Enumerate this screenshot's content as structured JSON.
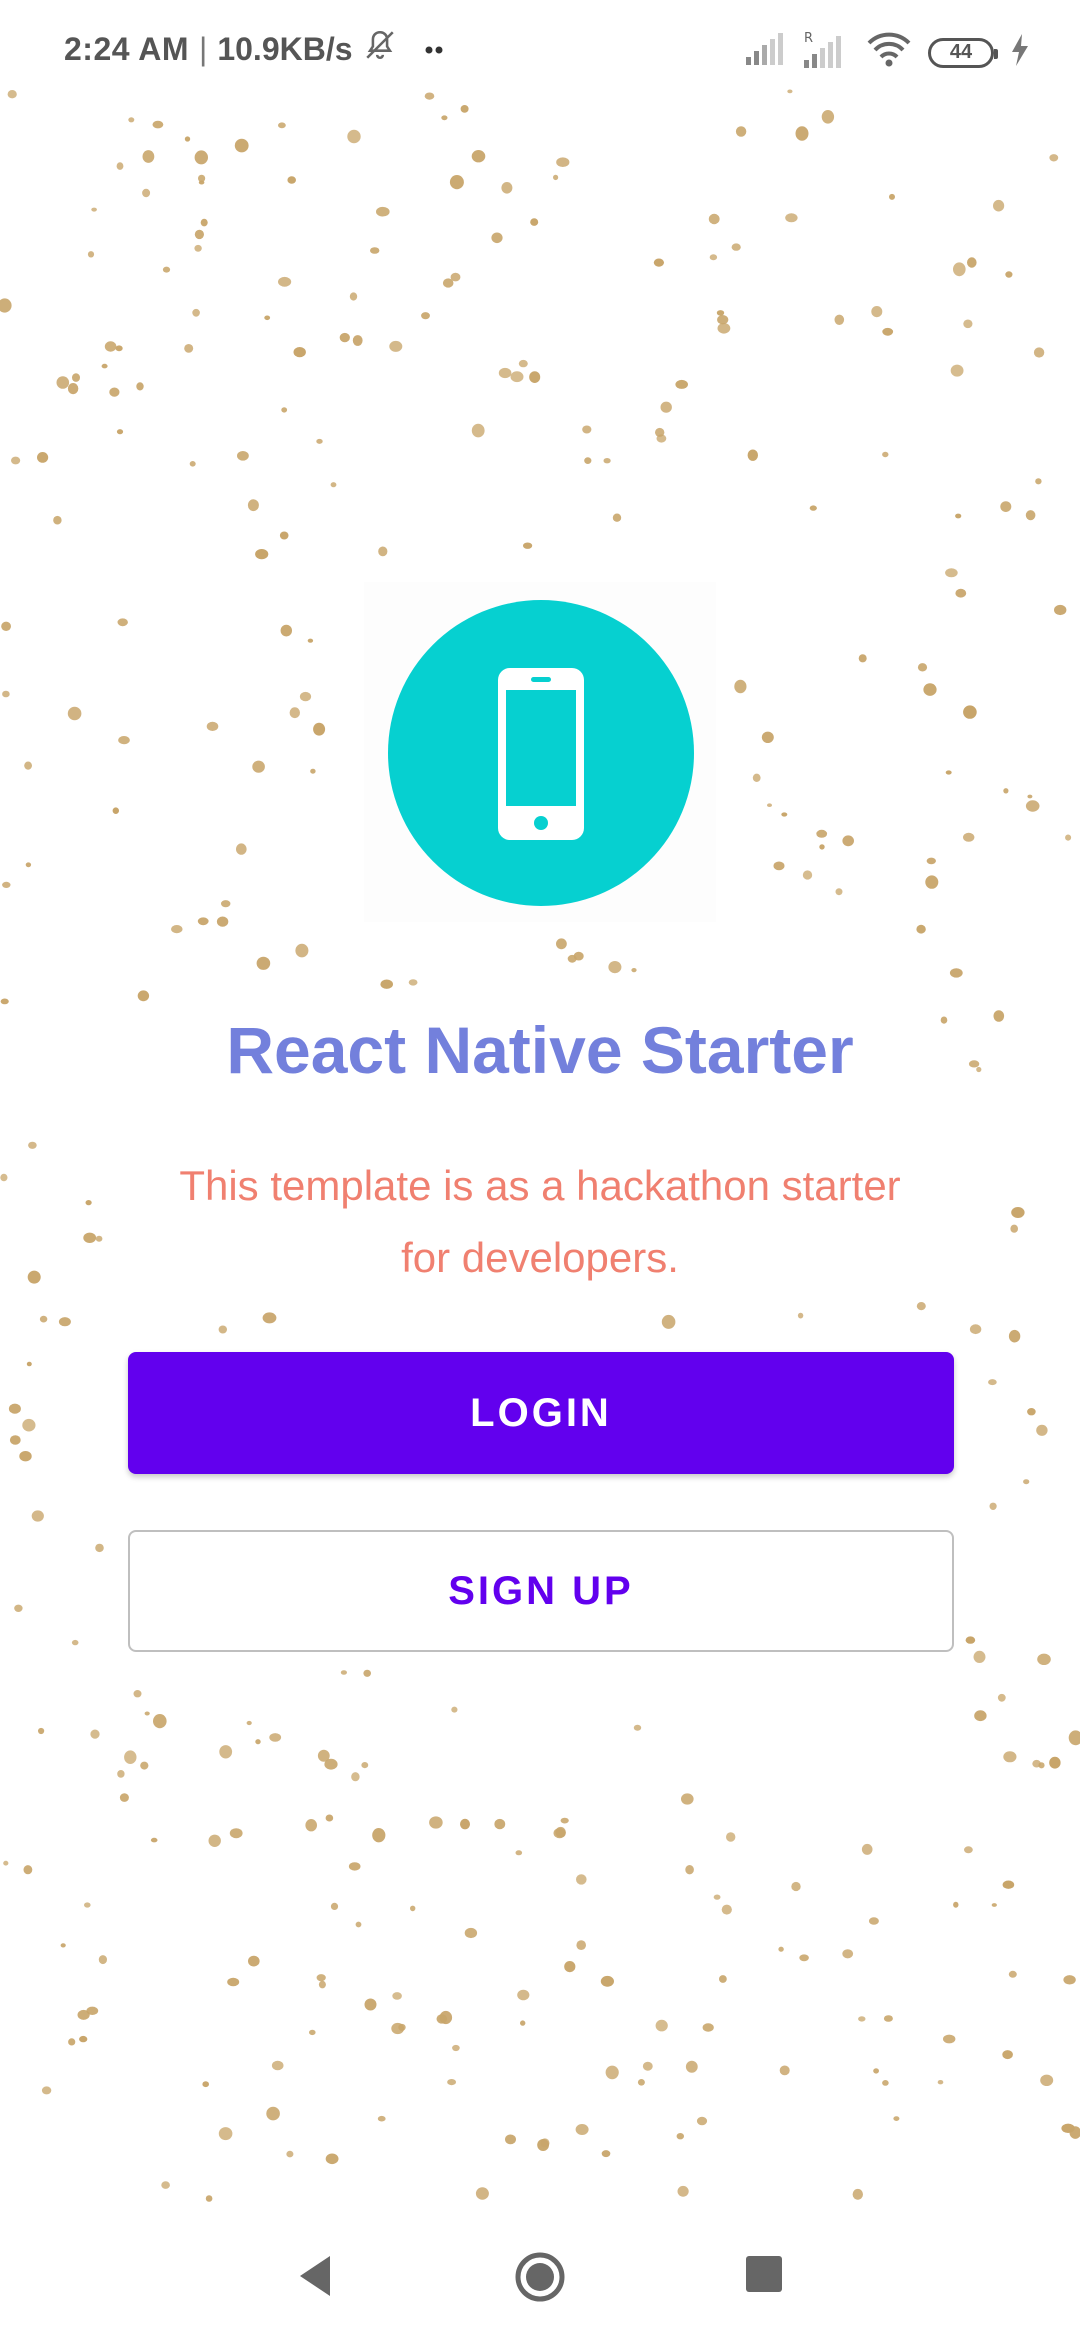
{
  "status_bar": {
    "time": "2:24 AM",
    "separator": "|",
    "network_speed": "10.9KB/s",
    "battery_level": "44",
    "icons": [
      "bell-muted-icon",
      "more-dots-icon",
      "signal-icon",
      "signal-roaming-icon",
      "wifi-icon",
      "battery-icon",
      "charging-bolt-icon"
    ]
  },
  "background": {
    "pattern": "confetti-dots",
    "dot_color": "#c8a56a"
  },
  "hero": {
    "logo_icon": "smartphone-icon",
    "logo_color": "#06d0d0",
    "title": "React Native Starter",
    "subtitle_line1": "This template is as a hackathon starter",
    "subtitle_line2": "for developers.",
    "title_color": "#7380dc",
    "subtitle_color": "#f08070"
  },
  "actions": {
    "login_label": "LOGIN",
    "signup_label": "SIGN UP",
    "accent_color": "#6200ee"
  },
  "nav_bar": {
    "icons": [
      "back-icon",
      "home-icon",
      "recents-icon"
    ]
  }
}
